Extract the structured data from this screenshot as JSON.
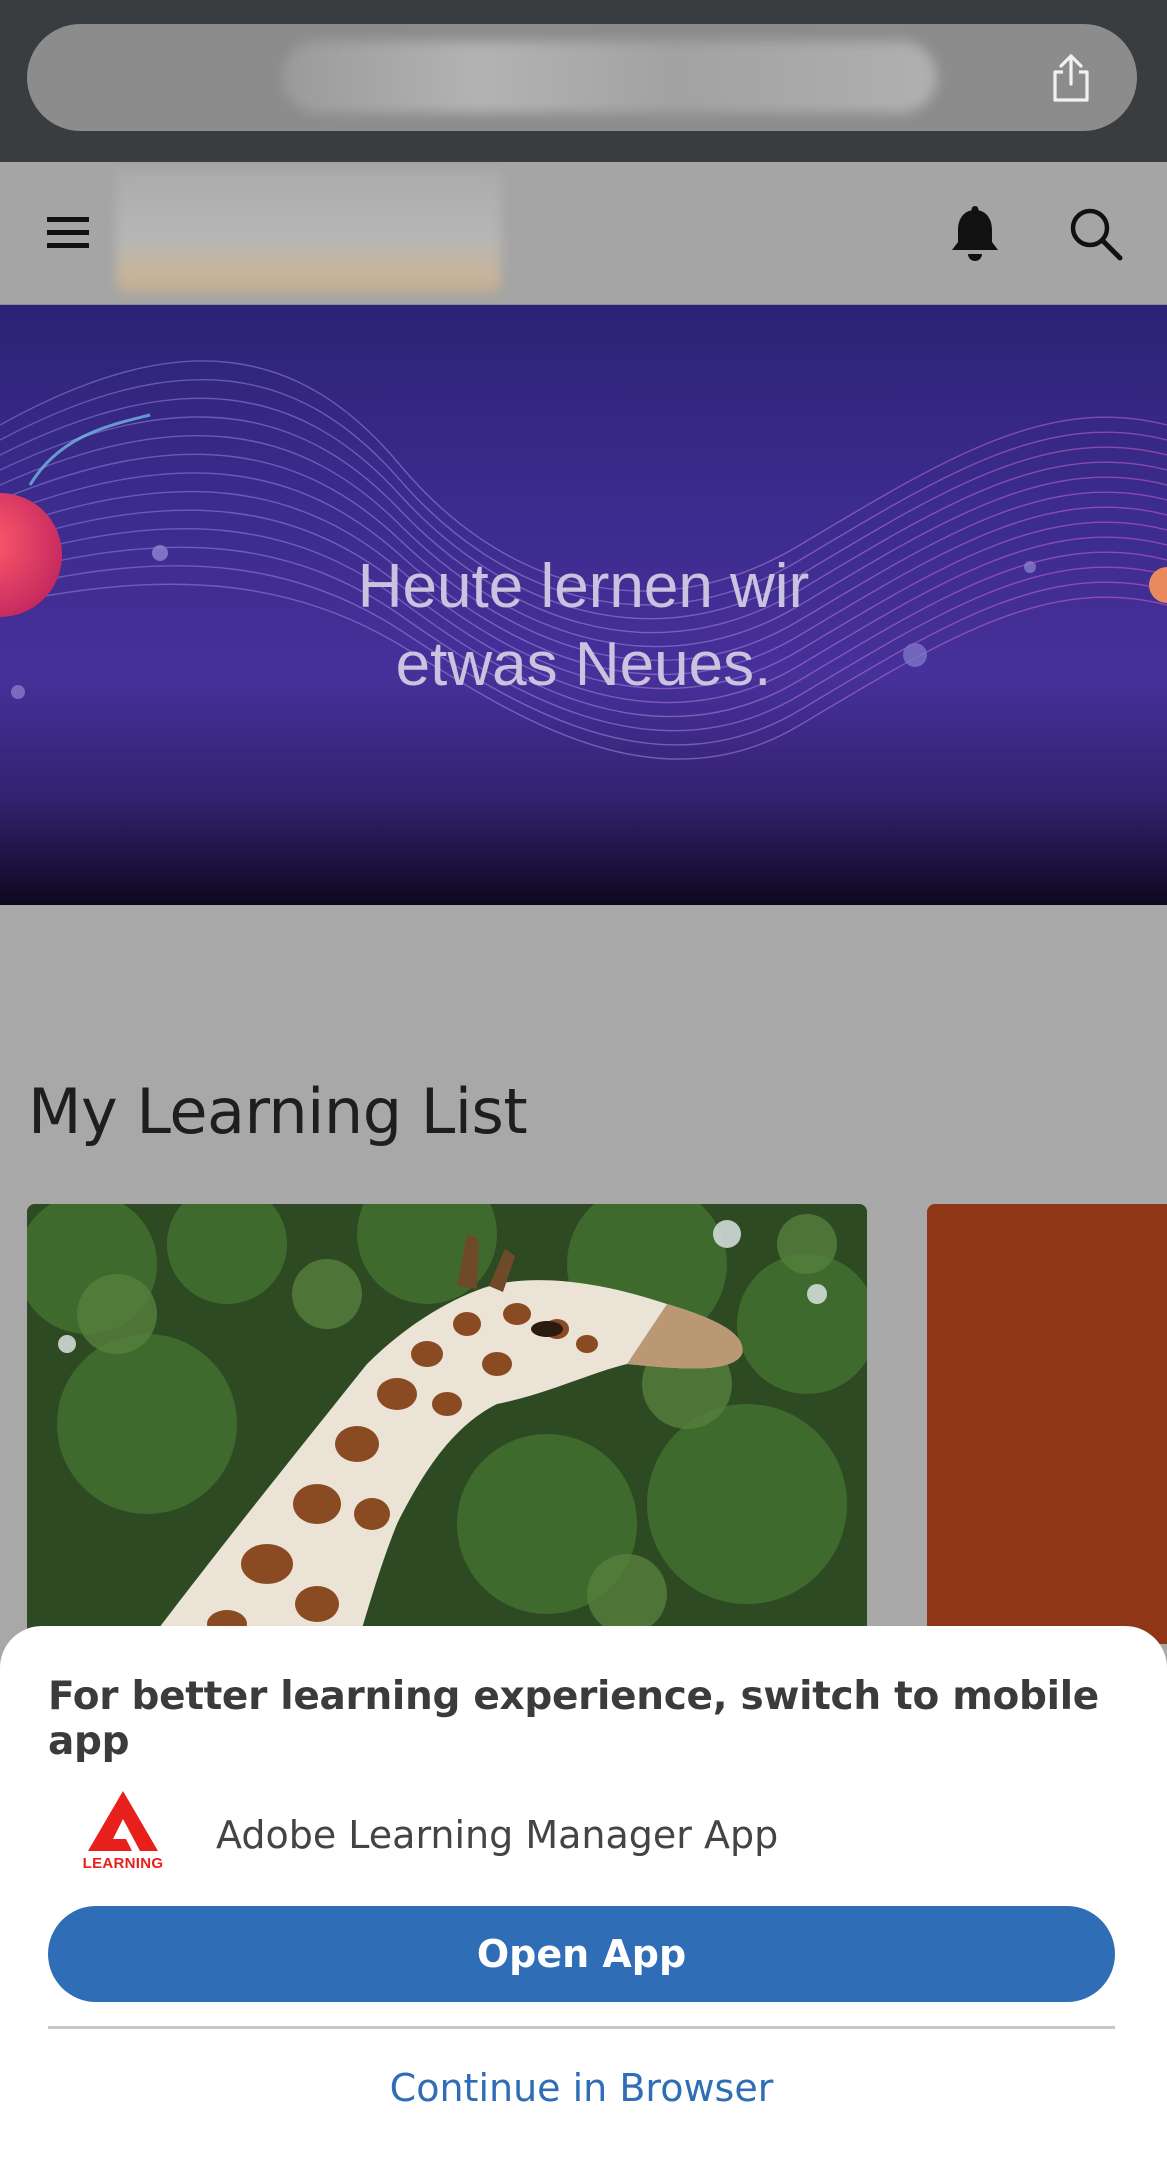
{
  "browser": {
    "share_icon": "share-icon"
  },
  "header": {
    "menu_icon": "hamburger-menu-icon",
    "bell_icon": "bell-icon",
    "search_icon": "search-icon"
  },
  "hero": {
    "line1": "Heute lernen wir",
    "line2": "etwas Neues."
  },
  "section": {
    "title": "My Learning List"
  },
  "sheet": {
    "title": "For better learning experience, switch to mobile app",
    "app_logo_text": "LEARNING",
    "app_name": "Adobe Learning Manager App",
    "open_button": "Open App",
    "continue_link": "Continue in Browser"
  },
  "colors": {
    "accent": "#2f6eb6",
    "adobe_red": "#e8201c",
    "hero_purple": "#46309a",
    "card_orange": "#8e3616"
  }
}
